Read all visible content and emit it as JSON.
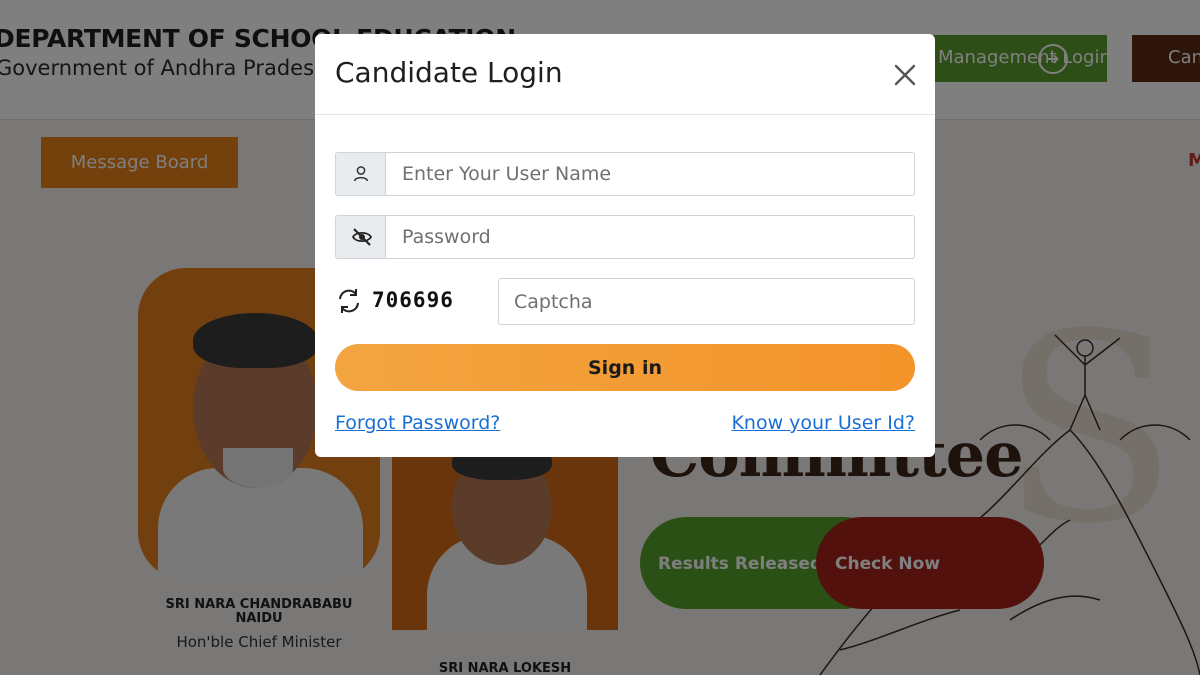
{
  "background": {
    "header": {
      "title": "DEPARTMENT OF SCHOOL EDUCATION",
      "subtitle": "Government of Andhra Pradesh",
      "management_login_label": "Management Login",
      "candidate_login_label": "Candidate Login"
    },
    "message_board_label": "Message Board",
    "right_edge_letter": "M",
    "leaders": [
      {
        "name": "SRI NARA CHANDRABABU NAIDU",
        "role": "Hon'ble Chief Minister"
      },
      {
        "name": "SRI NARA LOKESH"
      }
    ],
    "heading_fragment": "Committee",
    "results_label": "Results Released",
    "check_now_label": "Check Now"
  },
  "modal": {
    "title": "Candidate Login",
    "username_placeholder": "Enter Your User Name",
    "password_placeholder": "Password",
    "captcha_code": "706696",
    "captcha_placeholder": "Captcha",
    "signin_label": "Sign in",
    "forgot_password_label": "Forgot Password?",
    "know_user_id_label": "Know your User Id?"
  },
  "icons": {
    "username": "user-icon",
    "password": "eye-slash-icon",
    "captcha_refresh": "refresh-icon",
    "close": "close-icon"
  },
  "colors": {
    "signin_gradient_start": "#f3a540",
    "signin_gradient_end": "#f3932a",
    "link": "#1a6fd6",
    "management_button": "#5b9e2e",
    "candidate_button": "#5a2a12",
    "message_board": "#e8821a",
    "results_pill": "#56a12a",
    "check_now_pill": "#a7231d"
  }
}
